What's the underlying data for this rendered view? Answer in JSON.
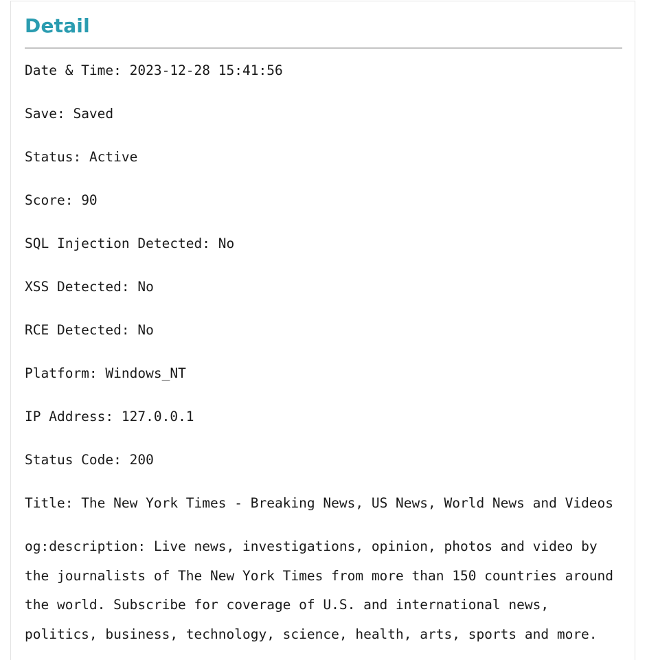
{
  "panel": {
    "title": "Detail"
  },
  "fields": [
    {
      "key": "date_time",
      "label": "Date & Time",
      "value": "2023-12-28 15:41:56"
    },
    {
      "key": "save",
      "label": "Save",
      "value": "Saved"
    },
    {
      "key": "status",
      "label": "Status",
      "value": "Active"
    },
    {
      "key": "score",
      "label": "Score",
      "value": "90"
    },
    {
      "key": "sql_injection",
      "label": "SQL Injection Detected",
      "value": "No"
    },
    {
      "key": "xss",
      "label": "XSS Detected",
      "value": "No"
    },
    {
      "key": "rce",
      "label": "RCE Detected",
      "value": "No"
    },
    {
      "key": "platform",
      "label": "Platform",
      "value": "Windows_NT"
    },
    {
      "key": "ip_address",
      "label": "IP Address",
      "value": "127.0.0.1"
    },
    {
      "key": "status_code",
      "label": "Status Code",
      "value": "200"
    },
    {
      "key": "title",
      "label": "Title",
      "value": "The New York Times - Breaking News, US News, World News and Videos"
    },
    {
      "key": "og_description",
      "label": "og:description",
      "value": "Live news, investigations, opinion, photos and video by the journalists of The New York Times from more than 150 countries around the world. Subscribe for coverage of U.S. and international news, politics, business, technology, science, health, arts, sports and more."
    }
  ],
  "colors": {
    "heading": "#2a9cb0",
    "text": "#1a1a1a",
    "rule": "#c4c4c4",
    "border": "#e3e3e3"
  }
}
